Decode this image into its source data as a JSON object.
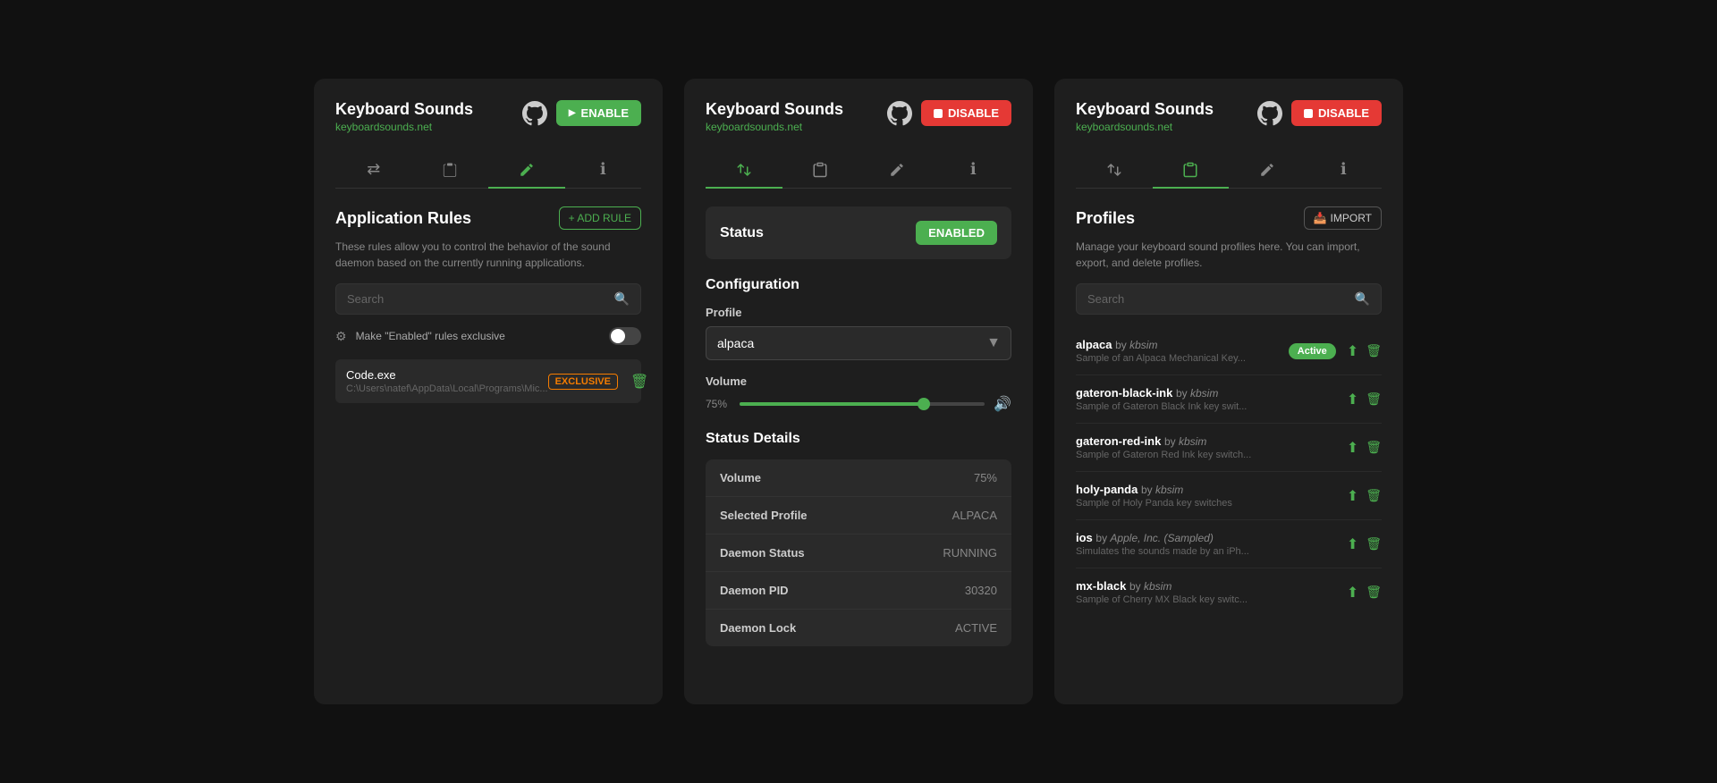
{
  "panels": {
    "left": {
      "title": "Keyboard Sounds",
      "subtitle": "keyboardsounds.net",
      "btn_enable": "ENABLE",
      "tabs": [
        {
          "icon": "⇄",
          "label": "swap-icon",
          "active": false
        },
        {
          "icon": "📋",
          "label": "clipboard-icon",
          "active": false
        },
        {
          "icon": "✏",
          "label": "rules-icon",
          "active": true
        },
        {
          "icon": "ℹ",
          "label": "info-icon",
          "active": false
        }
      ],
      "section_title": "Application Rules",
      "btn_add_rule": "+ ADD RULE",
      "description": "These rules allow you to control the behavior of the sound daemon based on the currently running applications.",
      "search_placeholder": "Search",
      "toggle_label": "Make \"Enabled\" rules exclusive",
      "rules": [
        {
          "name": "Code.exe",
          "path": "C:\\Users\\natef\\AppData\\Local\\Programs\\Mic...",
          "badge": "EXCLUSIVE"
        }
      ]
    },
    "middle": {
      "title": "Keyboard Sounds",
      "subtitle": "keyboardsounds.net",
      "btn_disable": "DISABLE",
      "tabs": [
        {
          "icon": "⇄",
          "label": "swap-icon",
          "active": true
        },
        {
          "icon": "📋",
          "label": "clipboard-icon",
          "active": false
        },
        {
          "icon": "✏",
          "label": "rules-icon",
          "active": false
        },
        {
          "icon": "ℹ",
          "label": "info-icon",
          "active": false
        }
      ],
      "status_label": "Status",
      "status_value": "ENABLED",
      "config_heading": "Configuration",
      "profile_label": "Profile",
      "profile_selected": "alpaca",
      "volume_label": "Volume",
      "volume_pct": "75%",
      "volume_value": 75,
      "status_details_heading": "Status Details",
      "status_rows": [
        {
          "label": "Volume",
          "value": "75%"
        },
        {
          "label": "Selected Profile",
          "value": "ALPACA"
        },
        {
          "label": "Daemon Status",
          "value": "RUNNING"
        },
        {
          "label": "Daemon PID",
          "value": "30320"
        },
        {
          "label": "Daemon Lock",
          "value": "ACTIVE"
        }
      ]
    },
    "right": {
      "title": "Keyboard Sounds",
      "subtitle": "keyboardsounds.net",
      "btn_disable": "DISABLE",
      "tabs": [
        {
          "icon": "⇄",
          "label": "swap-icon",
          "active": false
        },
        {
          "icon": "📋",
          "label": "clipboard-icon",
          "active": true
        },
        {
          "icon": "✏",
          "label": "rules-icon",
          "active": false
        },
        {
          "icon": "ℹ",
          "label": "info-icon",
          "active": false
        }
      ],
      "section_title": "Profiles",
      "btn_import": "IMPORT",
      "description": "Manage your keyboard sound profiles here. You can import, export, and delete profiles.",
      "search_placeholder": "Search",
      "profiles": [
        {
          "name": "alpaca",
          "by": "kbsim",
          "desc": "Sample of an Alpaca Mechanical Key...",
          "active": true
        },
        {
          "name": "gateron-black-ink",
          "by": "kbsim",
          "desc": "Sample of Gateron Black Ink key swit...",
          "active": false
        },
        {
          "name": "gateron-red-ink",
          "by": "kbsim",
          "desc": "Sample of Gateron Red Ink key switch...",
          "active": false
        },
        {
          "name": "holy-panda",
          "by": "kbsim",
          "desc": "Sample of Holy Panda key switches",
          "active": false
        },
        {
          "name": "ios",
          "by": "Apple, Inc. (Sampled)",
          "desc": "Simulates the sounds made by an iPh...",
          "active": false
        },
        {
          "name": "mx-black",
          "by": "kbsim",
          "desc": "Sample of Cherry MX Black key switc...",
          "active": false
        }
      ],
      "active_badge": "Active"
    }
  }
}
